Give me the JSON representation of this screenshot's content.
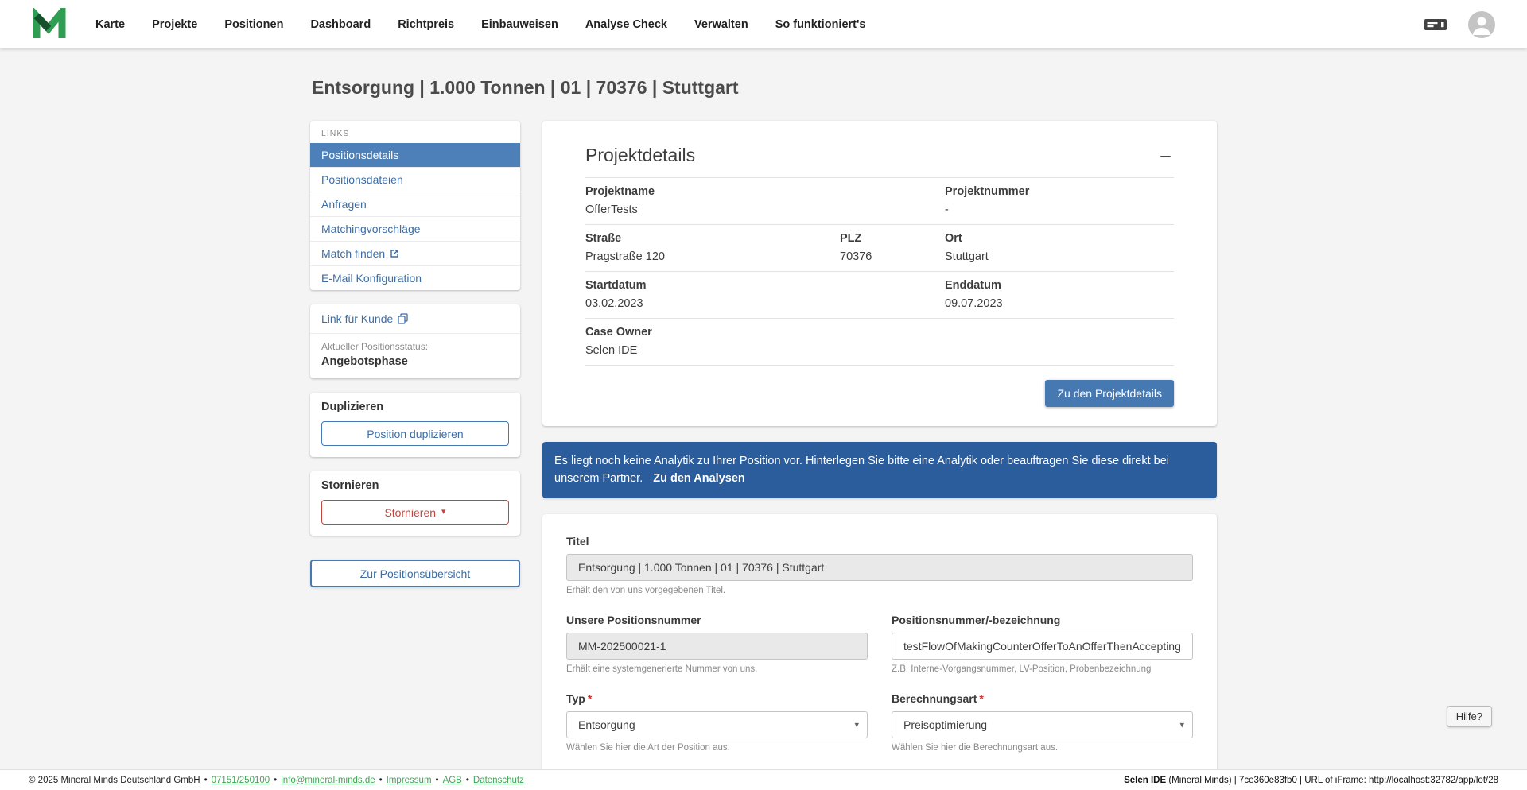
{
  "navbar": {
    "items": [
      "Karte",
      "Projekte",
      "Positionen",
      "Dashboard",
      "Richtpreis",
      "Einbauweisen",
      "Analyse Check",
      "Verwalten",
      "So funktioniert's"
    ]
  },
  "page": {
    "title": "Entsorgung | 1.000 Tonnen | 01 | 70376 | Stuttgart"
  },
  "sidebar": {
    "links_header": "LINKS",
    "links": [
      "Positionsdetails",
      "Positionsdateien",
      "Anfragen",
      "Matchingvorschläge",
      "Match finden",
      "E-Mail Konfiguration"
    ],
    "customer_link": "Link für Kunde",
    "status_label": "Aktueller Positionsstatus:",
    "status_value": "Angebotsphase",
    "duplicate_header": "Duplizieren",
    "duplicate_button": "Position duplizieren",
    "cancel_header": "Stornieren",
    "cancel_button": "Stornieren",
    "overview_button": "Zur Positionsübersicht"
  },
  "project_details": {
    "title": "Projektdetails",
    "fields": {
      "projektname": {
        "label": "Projektname",
        "value": "OfferTests"
      },
      "projektnummer": {
        "label": "Projektnummer",
        "value": "-"
      },
      "strasse": {
        "label": "Straße",
        "value": "Pragstraße 120"
      },
      "plz": {
        "label": "PLZ",
        "value": "70376"
      },
      "ort": {
        "label": "Ort",
        "value": "Stuttgart"
      },
      "startdatum": {
        "label": "Startdatum",
        "value": "03.02.2023"
      },
      "enddatum": {
        "label": "Enddatum",
        "value": "09.07.2023"
      },
      "case_owner": {
        "label": "Case Owner",
        "value": "Selen IDE"
      }
    },
    "details_button": "Zu den Projektdetails"
  },
  "banner": {
    "text": "Es liegt noch keine Analytik zu Ihrer Position vor. Hinterlegen Sie bitte eine Analytik oder beauftragen Sie diese direkt bei unserem Partner.",
    "link": "Zu den Analysen"
  },
  "form": {
    "titel": {
      "label": "Titel",
      "value": "Entsorgung | 1.000 Tonnen | 01 | 70376 | Stuttgart",
      "helper": "Erhält den von uns vorgegebenen Titel."
    },
    "unsere_positionsnummer": {
      "label": "Unsere Positionsnummer",
      "value": "MM-202500021-1",
      "helper": "Erhält eine systemgenerierte Nummer von uns."
    },
    "positionsnummer": {
      "label": "Positionsnummer/-bezeichnung",
      "value": "testFlowOfMakingCounterOfferToAnOfferThenAccepting",
      "helper": "Z.B. Interne-Vorgangsnummer, LV-Position, Probenbezeichnung"
    },
    "typ": {
      "label": "Typ",
      "required_mark": "*",
      "value": "Entsorgung",
      "helper": "Wählen Sie hier die Art der Position aus."
    },
    "berechnungsart": {
      "label": "Berechnungsart",
      "required_mark": "*",
      "value": "Preisoptimierung",
      "helper": "Wählen Sie hier die Berechnungsart aus."
    }
  },
  "help_button": "Hilfe?",
  "footer": {
    "copyright": "© 2025 Mineral Minds Deutschland GmbH",
    "separator": "•",
    "links": [
      "07151/250100",
      "info@mineral-minds.de",
      "Impressum",
      "AGB",
      "Datenschutz"
    ],
    "session_user": "Selen IDE",
    "session_rest": " (Mineral Minds) | 7ce360e83fb0 | URL of iFrame: http://localhost:32782/app/lot/28"
  },
  "icons": {
    "caret_down": "▾"
  },
  "colors": {
    "accent_blue": "#4678b2",
    "selected_blue": "#4d80b8",
    "banner_blue": "#2b5c9b",
    "link_blue": "#3c6da6",
    "danger_red": "#c5443c",
    "brand_green": "#3fa454"
  }
}
